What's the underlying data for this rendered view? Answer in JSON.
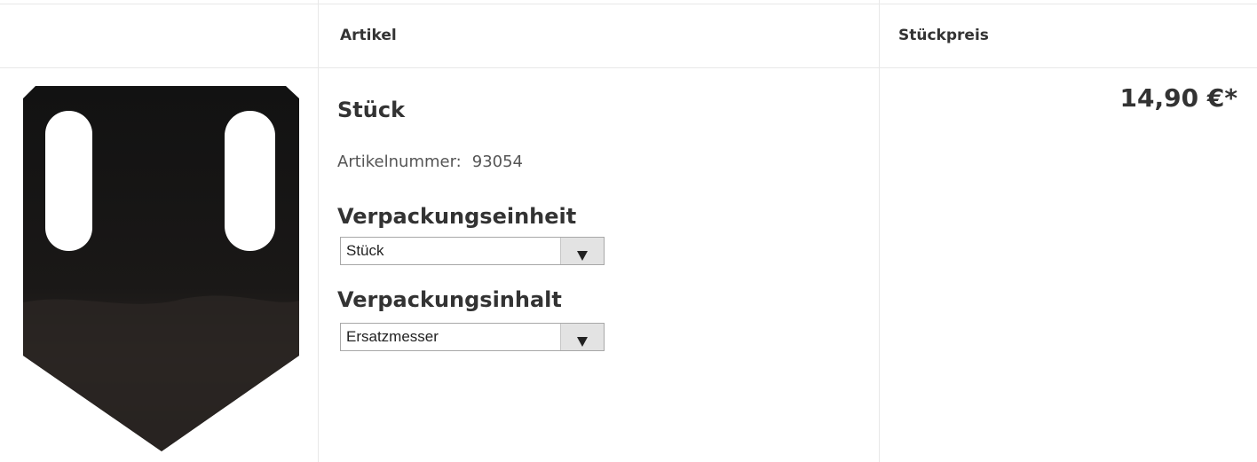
{
  "header": {
    "col_article": "Artikel",
    "col_price": "Stückpreis"
  },
  "product": {
    "title": "Stück",
    "article_number_label": "Artikelnummer:",
    "article_number": "93054",
    "image_icon": "blade-product-image",
    "options": [
      {
        "label": "Verpackungseinheit",
        "selected": "Stück"
      },
      {
        "label": "Verpackungsinhalt",
        "selected": "Ersatzmesser"
      }
    ],
    "price": "14,90 €*"
  },
  "colors": {
    "border": "#e8e8e8",
    "text": "#333333",
    "select_button": "#e3e3e3"
  }
}
